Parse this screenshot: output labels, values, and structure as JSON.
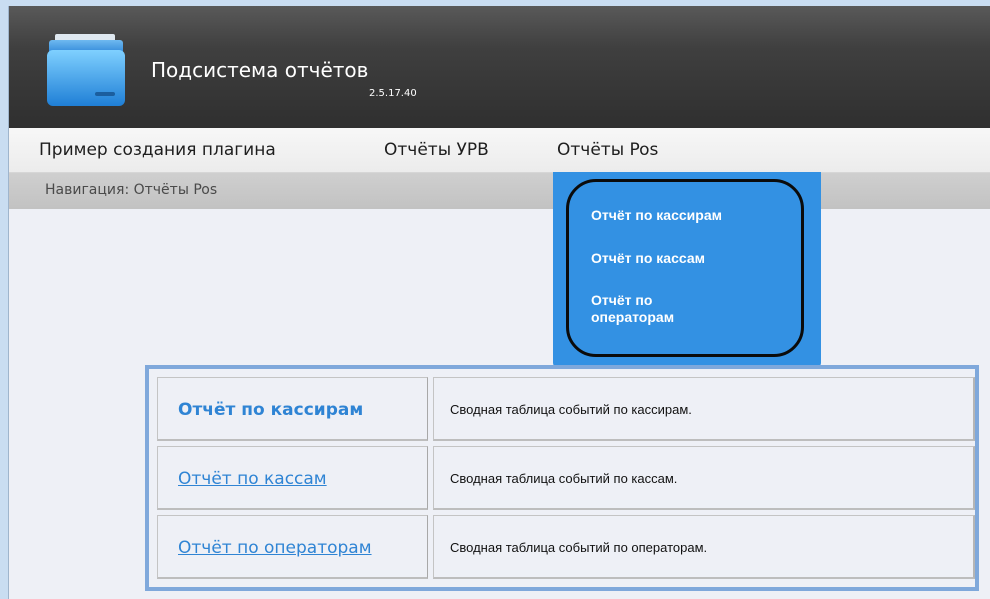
{
  "header": {
    "title": "Подсистема отчётов",
    "version": "2.5.17.40",
    "logo_icon": "folder-icon"
  },
  "menu": {
    "items": [
      {
        "label": "Пример создания плагина"
      },
      {
        "label": "Отчёты УРВ"
      },
      {
        "label": "Отчёты Pos"
      }
    ]
  },
  "breadcrumb": {
    "text": "Навигация: Отчёты Pos"
  },
  "dropdown": {
    "items": [
      {
        "label": "Отчёт по кассирам"
      },
      {
        "label": "Отчёт по кассам"
      },
      {
        "label": "Отчёт по операторам"
      }
    ]
  },
  "reports": {
    "rows": [
      {
        "name": "Отчёт по кассирам",
        "description": "Сводная таблица событий по кассирам."
      },
      {
        "name": "Отчёт по кассам",
        "description": "Сводная таблица событий по кассам."
      },
      {
        "name": "Отчёт по операторам",
        "description": "Сводная таблица событий по операторам."
      }
    ]
  },
  "colors": {
    "accent": "#3391e3",
    "link": "#2f84d4",
    "table_border": "#7fa8db"
  }
}
